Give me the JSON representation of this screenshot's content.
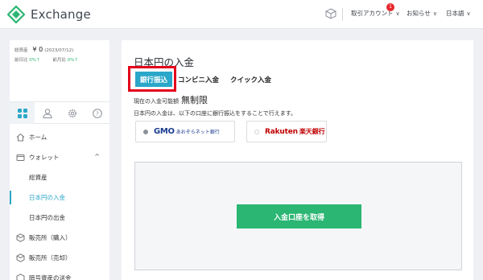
{
  "header": {
    "logo_text": "Exchange",
    "account_label": "取引アカウント",
    "account_badge": "1",
    "notice_label": "お知らせ",
    "language_label": "日本語",
    "chevron": "∨",
    "brand_color": "#2bb673"
  },
  "sidebar": {
    "balance_label": "総資産",
    "balance_value": "¥ 0",
    "balance_date": "(2023/07/12)",
    "prev_day_label": "前日比",
    "prev_day_value": "0%↑",
    "prev_month_label": "前月比",
    "prev_month_value": "0%↑",
    "tab_icons": [
      "grid-icon",
      "user-icon",
      "gear-icon",
      "help-icon"
    ],
    "items": [
      {
        "label": "ホーム",
        "icon": "home-icon"
      },
      {
        "label": "ウォレット",
        "icon": "wallet-icon"
      },
      {
        "label": "総資産"
      },
      {
        "label": "日本円の入金"
      },
      {
        "label": "日本円の出金"
      },
      {
        "label": "販売所（購入）",
        "icon": "cube-icon"
      },
      {
        "label": "販売所（売却）",
        "icon": "cube-icon"
      },
      {
        "label": "暗号資産の送金",
        "icon": "send-icon"
      }
    ]
  },
  "main": {
    "title": "日本円の入金",
    "tabs": [
      "銀行振込",
      "コンビニ入金",
      "クイック入金"
    ],
    "active_tab_index": 0,
    "limit_label": "現在の入金可能額",
    "limit_value": "無制限",
    "description": "日本円の入金は、以下の口座に銀行振込をすることで行えます。",
    "banks": [
      {
        "name": "GMO",
        "sub": "あおぞらネット銀行",
        "selected": true
      },
      {
        "name": "Rakuten",
        "sub": "楽天銀行",
        "selected": false
      }
    ],
    "deposit_button": "入金口座を取得",
    "accent_color": "#2aa7c9",
    "highlight_color": "#e3001b"
  }
}
